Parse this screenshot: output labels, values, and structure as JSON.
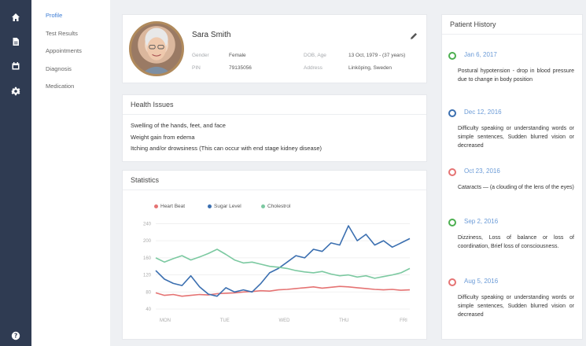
{
  "rail": {
    "icons": [
      "home-icon",
      "document-icon",
      "calendar-icon",
      "gear-icon",
      "help-icon"
    ]
  },
  "subnav": {
    "items": [
      {
        "label": "Profile",
        "active": true
      },
      {
        "label": "Test Results",
        "active": false
      },
      {
        "label": "Appointments",
        "active": false
      },
      {
        "label": "Diagnosis",
        "active": false
      },
      {
        "label": "Medication",
        "active": false
      }
    ]
  },
  "profile": {
    "name": "Sara Smith",
    "gender_label": "Gender",
    "gender": "Female",
    "pin_label": "PIN",
    "pin": "79135056",
    "dob_label": "DOB, Age",
    "dob": "13 Oct, 1979 - (37 years)",
    "address_label": "Address",
    "address": "Linköping, Sweden"
  },
  "health_issues": {
    "title": "Health Issues",
    "lines": [
      "Swelling of the hands, feet, and face",
      "Weight gain from edema",
      "Itching and/or drowsiness (This can occur with end stage kidney disease)"
    ]
  },
  "statistics": {
    "title": "Statistics"
  },
  "chart_data": {
    "type": "line",
    "x": [
      "MON",
      "TUE",
      "WED",
      "THU",
      "FRI"
    ],
    "y_ticks": [
      40,
      80,
      120,
      160,
      200,
      240
    ],
    "ylim": [
      40,
      250
    ],
    "series": [
      {
        "name": "Heart Beat",
        "color": "#e57373",
        "values": [
          78,
          72,
          74,
          70,
          72,
          74,
          73,
          76,
          77,
          78,
          80,
          81,
          83,
          82,
          85,
          86,
          88,
          90,
          92,
          89,
          91,
          93,
          92,
          90,
          88,
          86,
          85,
          86,
          84,
          85
        ]
      },
      {
        "name": "Sugar Level",
        "color": "#3b6fb0",
        "values": [
          130,
          110,
          100,
          95,
          118,
          92,
          75,
          70,
          90,
          80,
          85,
          80,
          100,
          125,
          135,
          150,
          165,
          160,
          180,
          175,
          195,
          190,
          235,
          200,
          215,
          190,
          200,
          185,
          195,
          205
        ]
      },
      {
        "name": "Cholestrol",
        "color": "#7cc9a1",
        "values": [
          160,
          150,
          158,
          165,
          155,
          162,
          170,
          180,
          168,
          155,
          148,
          150,
          145,
          140,
          138,
          135,
          130,
          127,
          125,
          128,
          122,
          118,
          120,
          115,
          118,
          112,
          116,
          120,
          125,
          135
        ]
      }
    ]
  },
  "history": {
    "title": "Patient History",
    "entries": [
      {
        "date": "Jan 6, 2017",
        "color": "#4caf50",
        "text": "Postural hypotension - drop in blood pressure due to change in body position"
      },
      {
        "date": "Dec 12, 2016",
        "color": "#3b6fb0",
        "text": "Difficulty speaking or understanding words or simple sentences, Sudden blurred vision or decreased"
      },
      {
        "date": "Oct 23, 2016",
        "color": "#e57373",
        "text": "Cataracts — (a clouding of the lens of the eyes)"
      },
      {
        "date": "Sep 2, 2016",
        "color": "#4caf50",
        "text": "Dizziness, Loss of balance or loss of coordination, Brief loss of consciousness."
      },
      {
        "date": "Aug 5, 2016",
        "color": "#e57373",
        "text": "Difficulty speaking or understanding words or simple sentences, Sudden blurred vision or decreased"
      }
    ]
  }
}
